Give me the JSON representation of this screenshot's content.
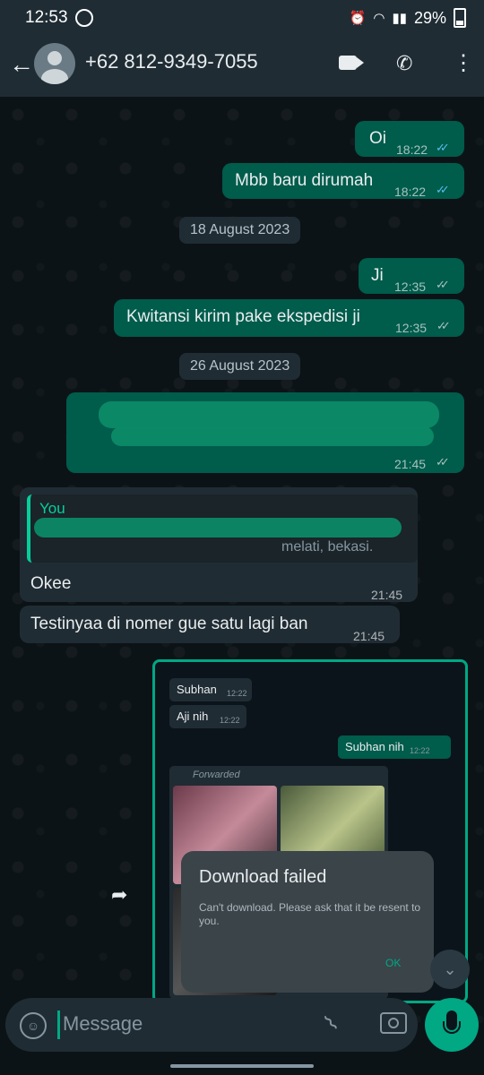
{
  "status_bar": {
    "time": "12:53",
    "battery": "29%"
  },
  "header": {
    "contact": "+62 812-9349-7055"
  },
  "messages": [
    {
      "dir": "out",
      "text": "Oi",
      "time": "18:22",
      "status": "read"
    },
    {
      "dir": "out",
      "text": "Mbb baru dirumah",
      "time": "18:22",
      "status": "read"
    },
    {
      "dir": "date",
      "text": "18 August 2023"
    },
    {
      "dir": "out",
      "text": "Ji",
      "time": "12:35",
      "status": "delivered"
    },
    {
      "dir": "out",
      "text": "Kwitansi kirim pake ekspedisi ji",
      "time": "12:35",
      "status": "delivered"
    },
    {
      "dir": "date",
      "text": "26 August 2023"
    },
    {
      "dir": "out",
      "text": "",
      "time": "21:45",
      "status": "delivered"
    },
    {
      "dir": "in",
      "quote_author": "You",
      "quote_fragment": "melati, bekasi.",
      "text": "Okee",
      "time": "21:45"
    },
    {
      "dir": "in",
      "text": "Testinyaa di nomer gue satu lagi ban",
      "time": "21:45"
    }
  ],
  "media_preview": {
    "bubbles": [
      {
        "text": "Subhan",
        "time": "12:22"
      },
      {
        "text": "Aji nih",
        "time": "12:22"
      },
      {
        "text": "Subhan nih",
        "time": "12:22"
      }
    ],
    "forwarded_label": "Forwarded"
  },
  "dialog": {
    "title": "Download failed",
    "message": "Can't download. Please ask that it be resent to you.",
    "ok": "OK"
  },
  "input": {
    "placeholder": "Message"
  },
  "colors": {
    "outgoing": "#005c4b",
    "incoming": "#202c33",
    "accent": "#00a884",
    "read_ticks": "#53bdeb"
  }
}
